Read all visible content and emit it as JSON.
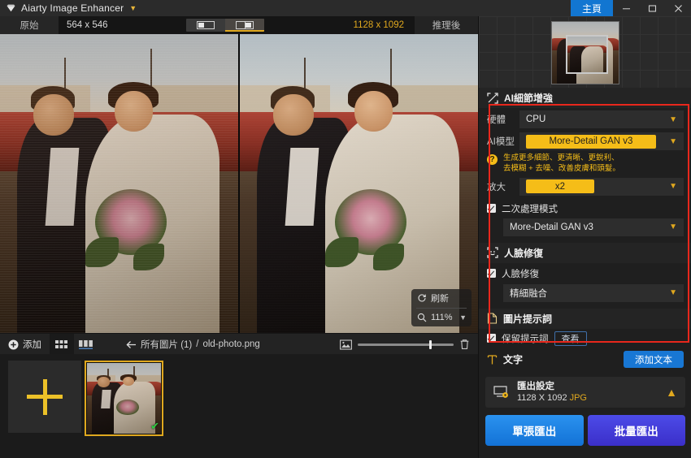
{
  "titlebar": {
    "logo_icon": "diamond-logo-icon",
    "app_title": "Aiarty Image Enhancer",
    "caret_icon": "chevron-down-icon",
    "home_label": "主頁",
    "minimize_icon": "minimize-icon",
    "maximize_icon": "maximize-icon",
    "close_icon": "close-icon"
  },
  "subbar": {
    "original_tab": "原始",
    "original_dimensions": "564 x 546",
    "view_single_icon": "single-view-icon",
    "view_split_icon": "split-view-icon",
    "result_dimensions": "1128 x 1092",
    "after_tab": "推理後"
  },
  "canvas": {
    "zoom": {
      "refresh_icon": "refresh-icon",
      "refresh_label": "刷新",
      "zoom_icon": "magnifier-icon",
      "zoom_level": "111%",
      "caret_icon": "chevron-down-icon"
    }
  },
  "filmbar": {
    "add_icon": "plus-circle-icon",
    "add_label": "添加",
    "grid_view_icon": "grid-view-icon",
    "filmstrip_view_icon": "filmstrip-view-icon",
    "back_icon": "arrow-left-icon",
    "breadcrumb_all": "所有圖片 (1)",
    "breadcrumb_sep": "/",
    "breadcrumb_file": "old-photo.png",
    "thumb_size_icon": "image-size-icon",
    "thumb_size_value": 75,
    "delete_icon": "trash-icon"
  },
  "strip": {
    "add_tile_icon": "plus-icon",
    "selected_check_icon": "check-icon"
  },
  "panel": {
    "preview": {
      "name": "result-preview-thumbnail"
    },
    "detail_section": {
      "icon": "ai-detail-enhance-icon",
      "title": "AI細節增強",
      "hardware_label": "硬體",
      "hardware_value": "CPU",
      "model_label": "AI模型",
      "model_value": "More-Detail GAN  v3",
      "help_icon": "question-mark-icon",
      "model_desc_line1": "生成更多細節、更清晰、更銳利、",
      "model_desc_line2": "去模糊 + 去噪、改善皮膚和頭髮。",
      "scale_label": "放大",
      "scale_value": "x2",
      "second_pass_label": "二次處理模式",
      "second_pass_checked": true,
      "second_pass_model": "More-Detail GAN  v3",
      "caret_icon": "chevron-down-icon"
    },
    "face_section": {
      "icon": "face-restore-icon",
      "title": "人臉修復",
      "checkbox_label": "人臉修復",
      "checkbox_checked": true,
      "mode_value": "精細融合",
      "caret_icon": "chevron-down-icon"
    },
    "prompt_section": {
      "icon": "document-icon",
      "title": "圖片提示詞",
      "keep_prompt_label": "保留提示詞",
      "keep_prompt_checked": true,
      "view_button": "查看"
    },
    "text_section": {
      "icon": "text-tool-icon",
      "title": "文字",
      "add_text_button": "添加文本"
    },
    "export": {
      "icon": "export-settings-icon",
      "title": "匯出設定",
      "dimensions": "1128 X 1092",
      "format": "JPG",
      "collapse_icon": "chevron-up-icon",
      "single_export": "單張匯出",
      "batch_export": "批量匯出"
    }
  },
  "colors": {
    "accent_yellow": "#f5bd18",
    "accent_gold": "#e0a81e",
    "primary_blue": "#1877d4",
    "batch_purple": "#3b2fc9",
    "annotation_red": "#e8271c"
  }
}
